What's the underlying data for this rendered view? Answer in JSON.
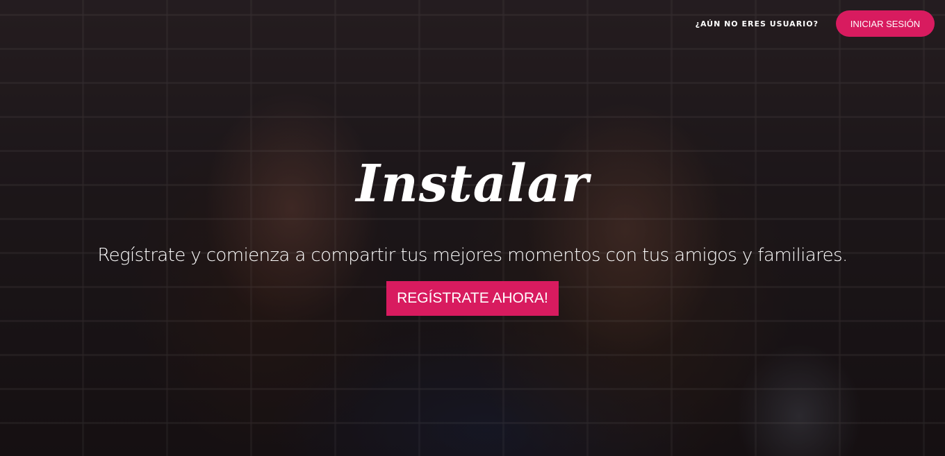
{
  "header": {
    "not_user_link": "¿AÚN NO ERES USUARIO?",
    "login_button": "INICIAR SESIÓN"
  },
  "hero": {
    "logo": "Instalar",
    "tagline": "Regístrate y comienza a compartir tus mejores momentos con tus amigos y familiares.",
    "cta_button": "REGÍSTRATE AHORA!"
  },
  "colors": {
    "accent": "#d81b5f",
    "text": "#ffffff"
  }
}
